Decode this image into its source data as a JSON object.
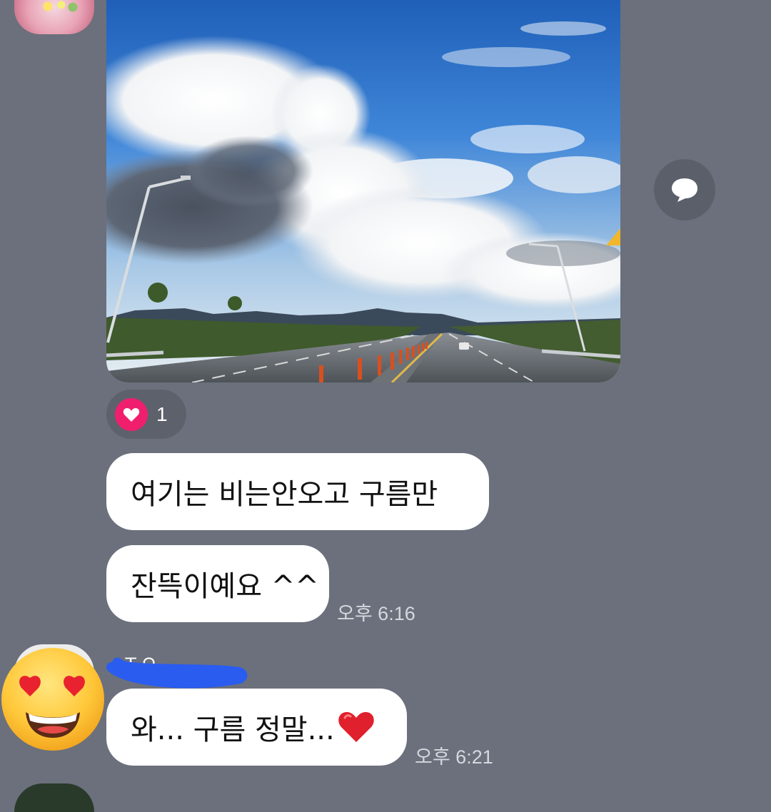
{
  "photo_message": {
    "reaction": {
      "emoji": "heart",
      "count": "1",
      "color": "#f01f6e"
    }
  },
  "messages_self": [
    {
      "text": "여기는 비는안오고 구름만"
    },
    {
      "text": "잔뜩이예요 ^^",
      "time": "오후 6:16"
    }
  ],
  "reply": {
    "sender_name": "ㅈㅇ",
    "text": "와...  구름 정말...",
    "time": "오후 6:21",
    "avatar_icon": "smiling-face-with-heart-eyes-icon",
    "trailing_icon": "red-heart-icon"
  },
  "colors": {
    "background": "#6b707c",
    "bubble": "#ffffff",
    "time_text": "#d6d8de",
    "redaction": "#2a5cf0"
  }
}
